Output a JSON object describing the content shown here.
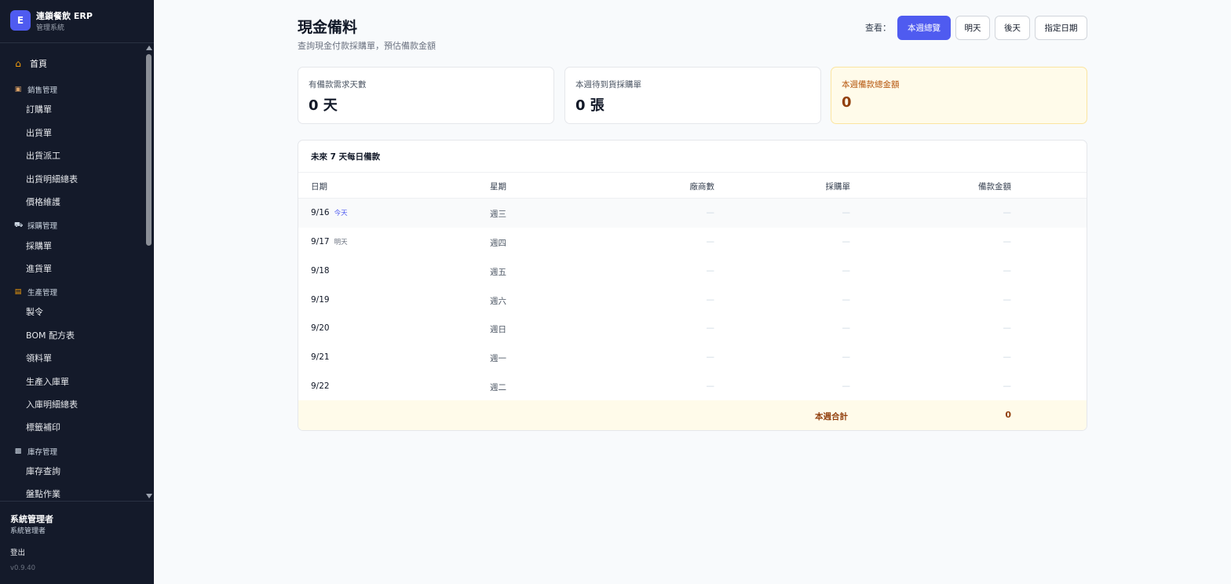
{
  "brand": {
    "logo": "E",
    "title": "連鎖餐飲 ERP",
    "subtitle": "管理系統"
  },
  "nav": {
    "home": {
      "label": "首頁",
      "icon": "house-icon"
    },
    "groups": [
      {
        "label": "銷售管理",
        "icon": "package-icon",
        "items": [
          "訂購單",
          "出貨單",
          "出貨派工",
          "出貨明細總表",
          "價格維護"
        ]
      },
      {
        "label": "採購管理",
        "icon": "truck-icon",
        "items": [
          "採購單",
          "進貨單"
        ]
      },
      {
        "label": "生產管理",
        "icon": "factory-icon",
        "items": [
          "製令",
          "BOM 配方表",
          "領料單",
          "生產入庫單",
          "入庫明細總表",
          "標籤補印"
        ]
      },
      {
        "label": "庫存管理",
        "icon": "warehouse-icon",
        "items": [
          "庫存查詢",
          "盤點作業"
        ]
      }
    ]
  },
  "user": {
    "name": "系統管理者",
    "role": "系統管理者",
    "logout": "登出",
    "version": "v0.9.40"
  },
  "header": {
    "title": "現金備料",
    "subtitle": "查詢現金付款採購單，預估備款金額"
  },
  "view": {
    "label": "查看：",
    "buttons": [
      {
        "label": "本週總覽",
        "active": true
      },
      {
        "label": "明天",
        "active": false
      },
      {
        "label": "後天",
        "active": false
      },
      {
        "label": "指定日期",
        "active": false
      }
    ]
  },
  "cards": [
    {
      "label": "有備款需求天數",
      "value": "0 天"
    },
    {
      "label": "本週待到貨採購單",
      "value": "0 張"
    },
    {
      "label": "本週備款總金額",
      "value": "0"
    }
  ],
  "table": {
    "title": "未來 7 天每日備款",
    "columns": [
      "日期",
      "星期",
      "廠商數",
      "採購單",
      "備款金額"
    ],
    "rows": [
      {
        "date": "9/16",
        "tag": "今天",
        "weekday": "週三",
        "vendors": "—",
        "orders": "—",
        "amount": "—"
      },
      {
        "date": "9/17",
        "tag": "明天",
        "weekday": "週四",
        "vendors": "—",
        "orders": "—",
        "amount": "—"
      },
      {
        "date": "9/18",
        "tag": "",
        "weekday": "週五",
        "vendors": "—",
        "orders": "—",
        "amount": "—"
      },
      {
        "date": "9/19",
        "tag": "",
        "weekday": "週六",
        "vendors": "—",
        "orders": "—",
        "amount": "—"
      },
      {
        "date": "9/20",
        "tag": "",
        "weekday": "週日",
        "vendors": "—",
        "orders": "—",
        "amount": "—"
      },
      {
        "date": "9/21",
        "tag": "",
        "weekday": "週一",
        "vendors": "—",
        "orders": "—",
        "amount": "—"
      },
      {
        "date": "9/22",
        "tag": "",
        "weekday": "週二",
        "vendors": "—",
        "orders": "—",
        "amount": "—"
      }
    ],
    "footer": {
      "label": "本週合計",
      "value": "0"
    }
  },
  "colors": {
    "accent": "#4f5bf0",
    "sidebar": "#141a2a",
    "warn_bg": "#fffbea",
    "warn_text": "#92400e"
  }
}
